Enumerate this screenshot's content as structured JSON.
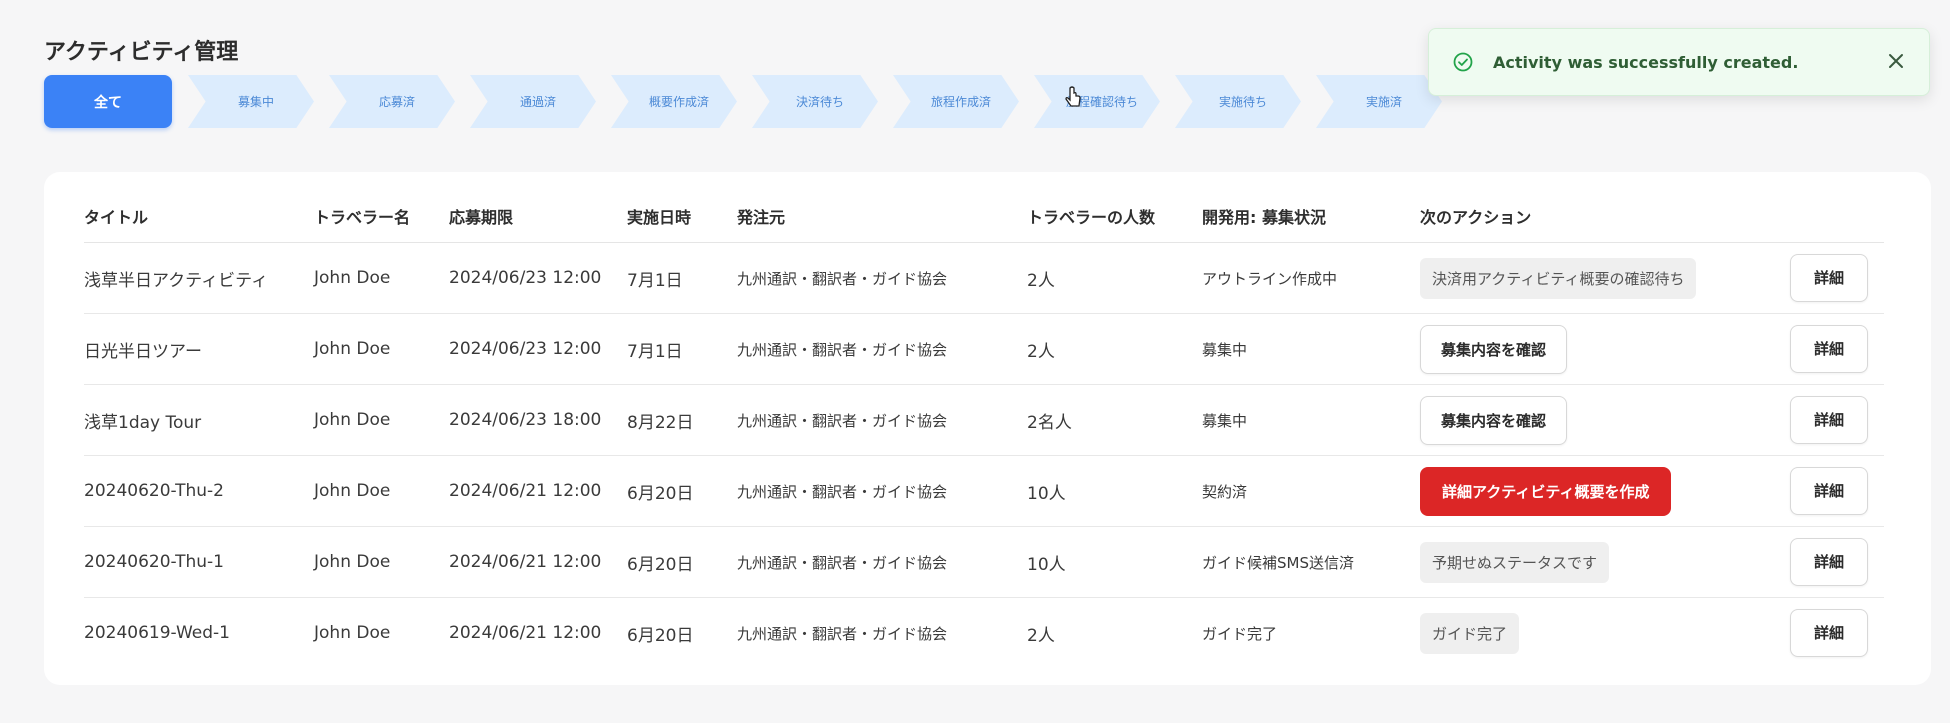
{
  "page": {
    "title": "アクティビティ管理"
  },
  "filters": {
    "all_label": "全て",
    "steps": [
      "募集中",
      "応募済",
      "通過済",
      "概要作成済",
      "決済待ち",
      "旅程作成済",
      "旅程確認待ち",
      "実施待ち",
      "実施済"
    ]
  },
  "table": {
    "columns": [
      "タイトル",
      "トラベラー名",
      "応募期限",
      "実施日時",
      "発注元",
      "トラベラーの人数",
      "開発用: 募集状況",
      "次のアクション",
      ""
    ],
    "detail_label": "詳細",
    "rows": [
      {
        "title": "浅草半日アクティビティ",
        "traveler": "John Doe",
        "deadline": "2024/06/23 12:00",
        "date": "7月1日",
        "client": "九州通訳・翻訳者・ガイド協会",
        "count": "2人",
        "status": "アウトライン作成中",
        "action": "決済用アクティビティ概要の確認待ち",
        "action_style": "pill"
      },
      {
        "title": "日光半日ツアー",
        "traveler": "John Doe",
        "deadline": "2024/06/23 12:00",
        "date": "7月1日",
        "client": "九州通訳・翻訳者・ガイド協会",
        "count": "2人",
        "status": "募集中",
        "action": "募集内容を確認",
        "action_style": "outline"
      },
      {
        "title": "浅草1day Tour",
        "traveler": "John Doe",
        "deadline": "2024/06/23 18:00",
        "date": "8月22日",
        "client": "九州通訳・翻訳者・ガイド協会",
        "count": "2名人",
        "status": "募集中",
        "action": "募集内容を確認",
        "action_style": "outline"
      },
      {
        "title": "20240620-Thu-2",
        "traveler": "John Doe",
        "deadline": "2024/06/21 12:00",
        "date": "6月20日",
        "client": "九州通訳・翻訳者・ガイド協会",
        "count": "10人",
        "status": "契約済",
        "action": "詳細アクティビティ概要を作成",
        "action_style": "red"
      },
      {
        "title": "20240620-Thu-1",
        "traveler": "John Doe",
        "deadline": "2024/06/21 12:00",
        "date": "6月20日",
        "client": "九州通訳・翻訳者・ガイド協会",
        "count": "10人",
        "status": "ガイド候補SMS送信済",
        "action": "予期せぬステータスです",
        "action_style": "pill"
      },
      {
        "title": "20240619-Wed-1",
        "traveler": "John Doe",
        "deadline": "2024/06/21 12:00",
        "date": "6月20日",
        "client": "九州通訳・翻訳者・ガイド協会",
        "count": "2人",
        "status": "ガイド完了",
        "action": "ガイド完了",
        "action_style": "pill"
      }
    ]
  },
  "toast": {
    "message": "Activity was successfully created.",
    "icon": "check-circle-icon",
    "close_icon": "close-icon",
    "accent": "#22a34a"
  },
  "colors": {
    "primary": "#3b82f6",
    "step_bg": "#dcecfd",
    "danger": "#dc2626"
  }
}
